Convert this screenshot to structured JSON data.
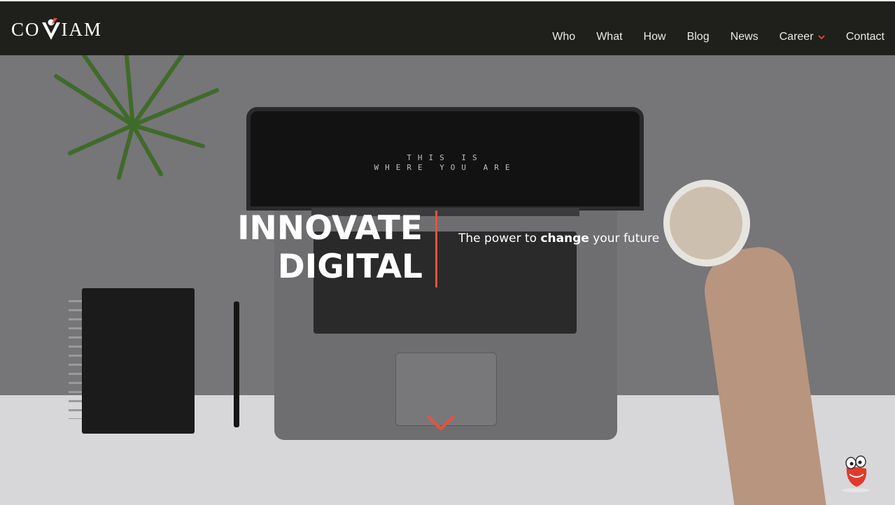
{
  "brand": {
    "name": "COVIAM",
    "prefix": "CO",
    "suffix": "IAM"
  },
  "nav": {
    "items": [
      {
        "label": "Who"
      },
      {
        "label": "What"
      },
      {
        "label": "How"
      },
      {
        "label": "Blog"
      },
      {
        "label": "News"
      },
      {
        "label": "Career",
        "has_dropdown": true
      },
      {
        "label": "Contact"
      }
    ]
  },
  "hero": {
    "headline_line1": "INNOVATE",
    "headline_line2": "DIGITAL",
    "tagline_pre": "The power to ",
    "tagline_bold": "change",
    "tagline_post": " your future",
    "screen_line1": "THIS IS",
    "screen_line2": "WHERE YOU ARE"
  },
  "icons": {
    "scroll": "chevron-down-icon",
    "caret": "chevron-down-icon",
    "mascot": "mascot-icon"
  },
  "colors": {
    "accent": "#e8513f",
    "header_bg": "#1f1f1c",
    "nav_text": "#e9e9e9"
  }
}
